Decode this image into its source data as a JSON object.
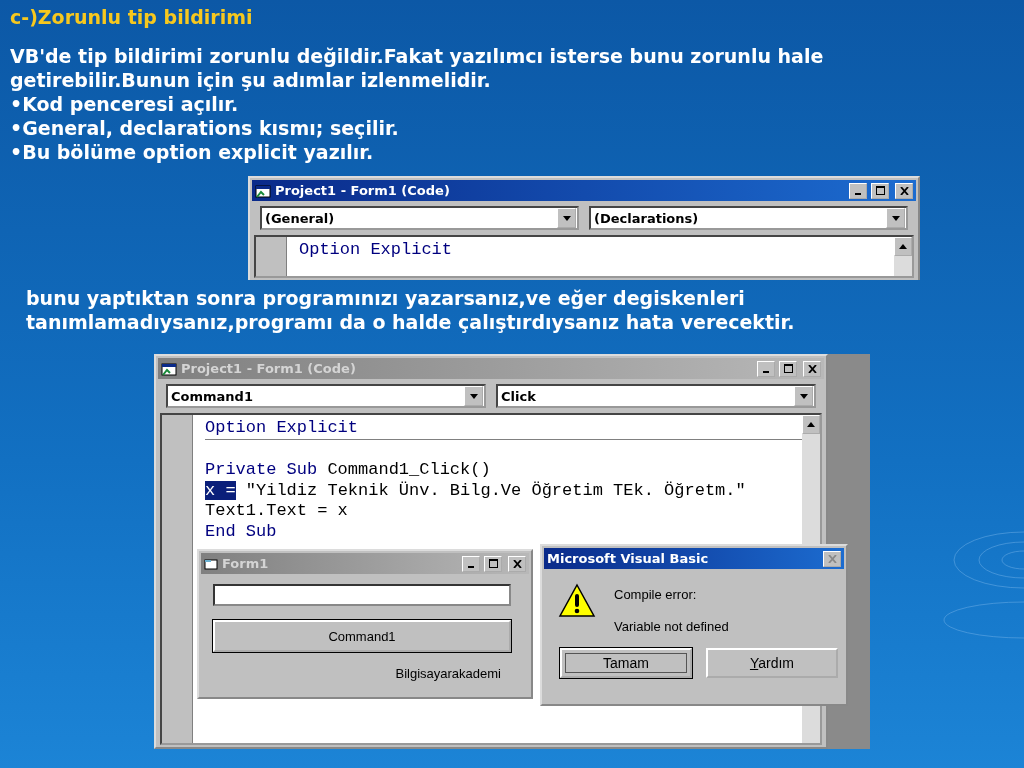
{
  "slide": {
    "heading": "c-)Zorunlu tip bildirimi",
    "intro": "VB'de tip bildirimi zorunlu değildir.Fakat yazılımcı isterse bunu zorunlu hale getirebilir.Bunun için şu adımlar izlenmelidir.",
    "bullets": [
      "•Kod penceresi açılır.",
      "•General, declarations kısmı; seçilir.",
      "•Bu bölüme option explicit yazılır."
    ],
    "note": "bunu yaptıktan sonra programınızı yazarsanız,ve eğer degiskenleri tanımlamadıysanız,programı da o halde çalıştırdıysanız hata verecektir."
  },
  "code_window_1": {
    "title": "Project1 - Form1 (Code)",
    "active": true,
    "object_combo": "(General)",
    "procedure_combo": "(Declarations)",
    "lines": [
      {
        "parts": [
          {
            "text": "Option Explicit",
            "kind": "keyword"
          }
        ]
      }
    ]
  },
  "code_window_2": {
    "title": "Project1 - Form1 (Code)",
    "active": false,
    "object_combo": "Command1",
    "procedure_combo": "Click",
    "lines": [
      {
        "separator_below": true,
        "parts": [
          {
            "text": "Option Explicit",
            "kind": "keyword"
          }
        ]
      },
      {
        "blank": true
      },
      {
        "parts": [
          {
            "text": "Private Sub",
            "kind": "keyword"
          },
          {
            "text": " Command1_Click()",
            "kind": "plain"
          }
        ]
      },
      {
        "parts": [
          {
            "text": "x =",
            "kind": "selected"
          },
          {
            "text": " \"Yildiz Teknik Ünv. Bilg.Ve Öğretim TEk. Öğretm.\"",
            "kind": "plain"
          }
        ]
      },
      {
        "parts": [
          {
            "text": "Text1.Text = x",
            "kind": "plain"
          }
        ]
      },
      {
        "parts": [
          {
            "text": "End Sub",
            "kind": "keyword"
          }
        ]
      }
    ]
  },
  "form_window": {
    "title": "Form1",
    "active": false,
    "button": "Command1",
    "label": "Bilgisayarakademi"
  },
  "dialog": {
    "title": "Microsoft Visual Basic",
    "active": true,
    "messages": [
      "Compile error:",
      "Variable not defined"
    ],
    "buttons": [
      {
        "label": "Tamam",
        "focused": true,
        "mnemonic": false
      },
      {
        "label": "Yardım",
        "focused": false,
        "mnemonic": true
      }
    ]
  }
}
